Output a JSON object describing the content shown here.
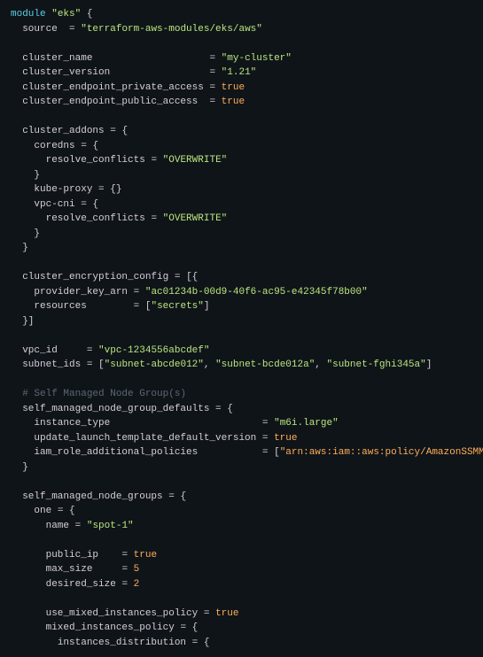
{
  "module_kw": "module",
  "module_name": "\"eks\"",
  "source_attr": "source",
  "source_val": "\"terraform-aws-modules/eks/aws\"",
  "cluster_name_attr": "cluster_name",
  "cluster_name_val": "\"my-cluster\"",
  "cluster_version_attr": "cluster_version",
  "cluster_version_val": "\"1.21\"",
  "cepra_attr": "cluster_endpoint_private_access",
  "cepra_val": "true",
  "cepua_attr": "cluster_endpoint_public_access",
  "cepua_val": "true",
  "cluster_addons_attr": "cluster_addons",
  "coredns_key": "coredns",
  "resolve_conflicts_attr": "resolve_conflicts",
  "overwrite_val": "\"OVERWRITE\"",
  "kube_proxy_key": "kube-proxy",
  "vpc_cni_key": "vpc-cni",
  "cec_attr": "cluster_encryption_config",
  "provider_key_arn_attr": "provider_key_arn",
  "provider_key_arn_val": "\"ac01234b-00d9-40f6-ac95-e42345f78b00\"",
  "resources_attr": "resources",
  "resources_val": "\"secrets\"",
  "vpc_id_attr": "vpc_id",
  "vpc_id_val": "\"vpc-1234556abcdef\"",
  "subnet_ids_attr": "subnet_ids",
  "subnet1": "\"subnet-abcde012\"",
  "subnet2": "\"subnet-bcde012a\"",
  "subnet3": "\"subnet-fghi345a\"",
  "comment_self": "# Self Managed Node Group(s)",
  "smngd_attr": "self_managed_node_group_defaults",
  "instance_type_attr": "instance_type",
  "instance_type_val": "\"m6i.large\"",
  "ultdv_attr": "update_launch_template_default_version",
  "ultdv_val": "true",
  "irap_attr": "iam_role_additional_policies",
  "irap_val": "\"arn:aws:iam::aws:policy/AmazonSSMManagedInstanceCore\"",
  "smng_attr": "self_managed_node_groups",
  "one_key": "one",
  "name_attr": "name",
  "name_val": "\"spot-1\"",
  "public_ip_attr": "public_ip",
  "public_ip_val": "true",
  "max_size_attr": "max_size",
  "max_size_val": "5",
  "desired_size_attr": "desired_size",
  "desired_size_val": "2",
  "umip_attr": "use_mixed_instances_policy",
  "umip_val": "true",
  "mip_attr": "mixed_instances_policy",
  "id_attr": "instances_distribution"
}
